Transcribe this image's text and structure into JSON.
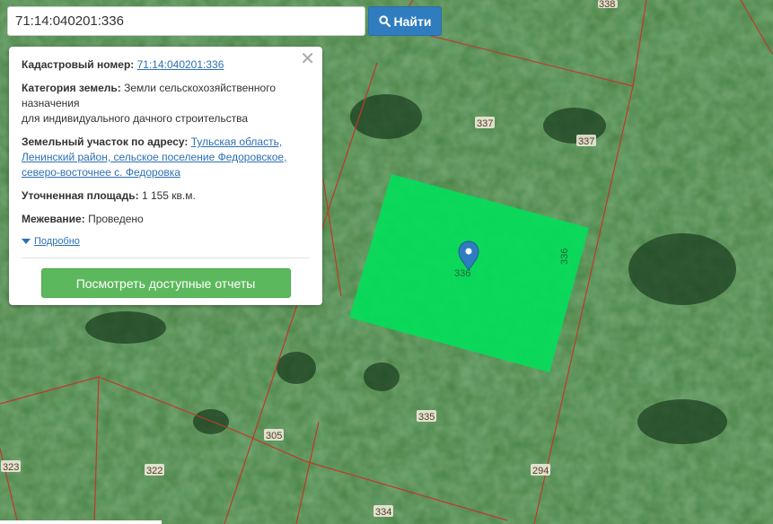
{
  "search": {
    "value": "71:14:040201:336",
    "button_label": "Найти"
  },
  "info_panel": {
    "cadastral_label": "Кадастровый номер:",
    "cadastral_value": "71:14:040201:336",
    "category_label": "Категория земель:",
    "category_value_line1": "Земли сельскохозяйственного",
    "category_value_line2": "назначения",
    "category_value_line3": "для индивидуального дачного строительства",
    "address_label": "Земельный участок по адресу:",
    "address_value_line1": "Тульская область,",
    "address_value_line2": "Ленинский район, сельское поселение Федоровское,",
    "address_value_line3": "северо-восточнее с. Федоровка",
    "area_label": "Уточненная площадь:",
    "area_value": "1 155 кв.м.",
    "survey_label": "Межевание:",
    "survey_value": "Проведено",
    "details_label": "Подробно",
    "reports_button_label": "Посмотреть доступные отчеты"
  },
  "map": {
    "parcel_labels": {
      "p338": "338",
      "p337a": "337",
      "p337b": "337",
      "p336": "336",
      "p336side": "336",
      "p335": "335",
      "p305": "305",
      "p322": "322",
      "p323": "323",
      "p294": "294",
      "p334": "334"
    },
    "colors": {
      "selected_parcel": "#00e05a",
      "boundary": "#c0392b",
      "marker": "#2f7dbf"
    }
  }
}
